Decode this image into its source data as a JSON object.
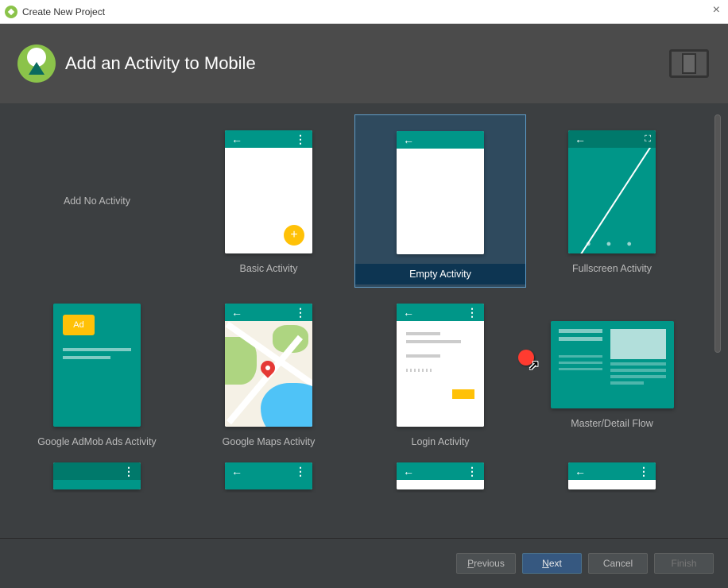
{
  "window": {
    "title": "Create New Project"
  },
  "header": {
    "title": "Add an Activity to Mobile"
  },
  "activities": [
    {
      "label": "Add No Activity"
    },
    {
      "label": "Basic Activity"
    },
    {
      "label": "Empty Activity"
    },
    {
      "label": "Fullscreen Activity"
    },
    {
      "label": "Google AdMob Ads Activity",
      "ad_text": "Ad"
    },
    {
      "label": "Google Maps Activity"
    },
    {
      "label": "Login Activity"
    },
    {
      "label": "Master/Detail Flow"
    }
  ],
  "selected_index": 2,
  "buttons": {
    "previous": "Previous",
    "next": "Next",
    "cancel": "Cancel",
    "finish": "Finish"
  }
}
